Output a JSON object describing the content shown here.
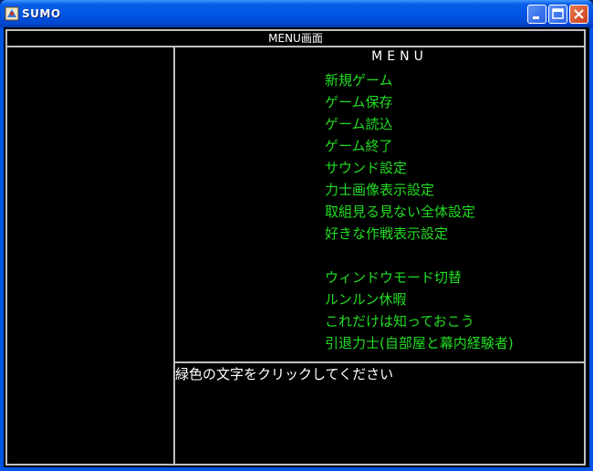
{
  "window": {
    "title": "SUMO",
    "icons": {
      "app": "sumo-app-icon",
      "minimize": "minimize-icon",
      "maximize": "maximize-icon",
      "close": "close-icon"
    },
    "colors": {
      "titlebar": "#0055e5",
      "close": "#c8401b"
    }
  },
  "header": {
    "title": "MENU画面"
  },
  "menu": {
    "title": "MENU",
    "items": [
      "新規ゲーム",
      "ゲーム保存",
      "ゲーム読込",
      "ゲーム終了",
      "サウンド設定",
      "力士画像表示設定",
      "取組見る見ない全体設定",
      "好きな作戦表示設定"
    ],
    "items2": [
      "ウィンドウモード切替",
      "ルンルン休暇",
      "これだけは知っておこう",
      "引退力士(自部屋と幕内経験者)"
    ],
    "item_color": "#22dd22"
  },
  "message": {
    "text": "緑色の文字をクリックしてください"
  }
}
